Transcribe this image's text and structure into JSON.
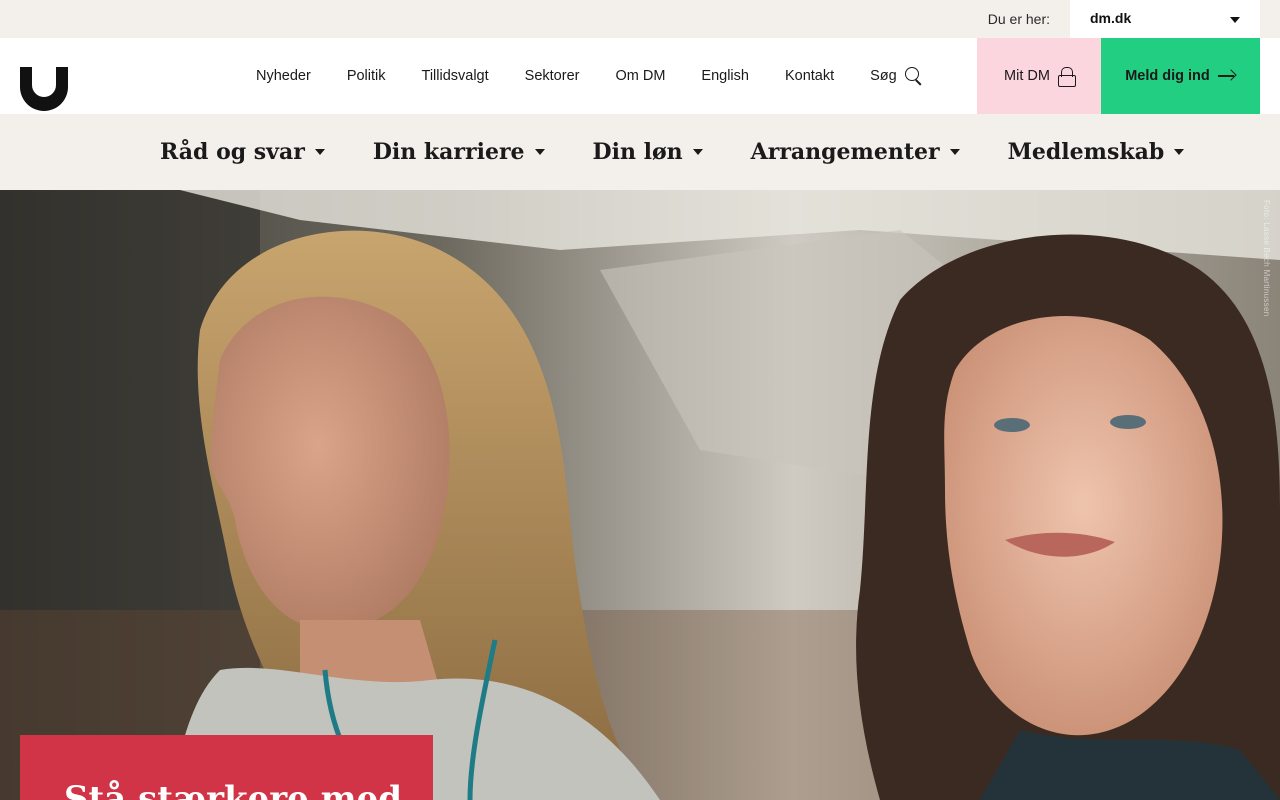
{
  "top_strip": {
    "location_label": "Du er her:",
    "site_selected": "dm.dk"
  },
  "header": {
    "utility_nav": [
      "Nyheder",
      "Politik",
      "Tillidsvalgt",
      "Sektorer",
      "Om DM",
      "English",
      "Kontakt"
    ],
    "search_label": "Søg",
    "mit_dm_label": "Mit DM",
    "join_label": "Meld dig ind"
  },
  "logo": {
    "alt": "DM"
  },
  "main_nav": [
    "Råd og svar",
    "Din karriere",
    "Din løn",
    "Arrangementer",
    "Medlemskab"
  ],
  "hero": {
    "photo_credit": "Foto: Lasse Bech Martinussen",
    "headline": "Stå stærkere med"
  },
  "colors": {
    "strip_bg": "#f3f0ec",
    "mit_dm_bg": "#fcd6de",
    "join_bg": "#22cf82",
    "card_bg": "#d13446"
  }
}
